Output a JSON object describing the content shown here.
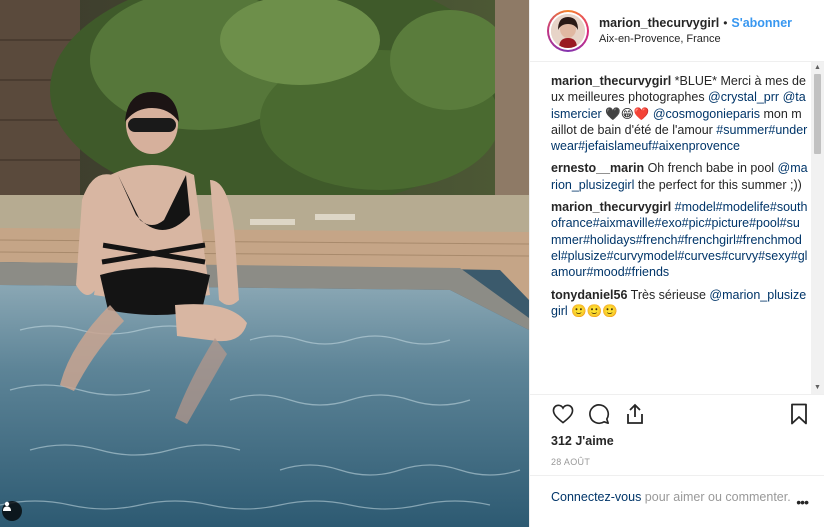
{
  "header": {
    "username": "marion_thecurvygirl",
    "separator": "•",
    "follow_label": "S'abonner",
    "location": "Aix-en-Provence, France"
  },
  "comments": [
    {
      "username": "marion_thecurvygirl",
      "parts": [
        {
          "text": " *BLUE* Merci à mes deux meilleures photographes ",
          "link": false
        },
        {
          "text": "@crystal_prr",
          "link": true
        },
        {
          "text": " ",
          "link": false
        },
        {
          "text": "@taismercier",
          "link": true
        },
        {
          "text": " 🖤😁❤️ ",
          "link": false
        },
        {
          "text": "@cosmogonieparis",
          "link": true
        },
        {
          "text": " mon maillot de bain d'été de l'amour ",
          "link": false
        },
        {
          "text": "#summer",
          "link": true
        },
        {
          "text": "#underwear",
          "link": true
        },
        {
          "text": "#jefaislameuf",
          "link": true
        },
        {
          "text": "#aixenprovence",
          "link": true
        }
      ]
    },
    {
      "username": "ernesto__marin",
      "parts": [
        {
          "text": " Oh french babe in pool ",
          "link": false
        },
        {
          "text": "@marion_plusizegirl",
          "link": true
        },
        {
          "text": " the perfect for this summer ;))",
          "link": false
        }
      ]
    },
    {
      "username": "marion_thecurvygirl",
      "parts": [
        {
          "text": " ",
          "link": false
        },
        {
          "text": "#model",
          "link": true
        },
        {
          "text": "#modelife",
          "link": true
        },
        {
          "text": "#southofrance",
          "link": true
        },
        {
          "text": "#aixmaville",
          "link": true
        },
        {
          "text": "#exo",
          "link": true
        },
        {
          "text": "#pic",
          "link": true
        },
        {
          "text": "#picture",
          "link": true
        },
        {
          "text": "#pool",
          "link": true
        },
        {
          "text": "#summer",
          "link": true
        },
        {
          "text": "#holidays",
          "link": true
        },
        {
          "text": "#french",
          "link": true
        },
        {
          "text": "#frenchgirl",
          "link": true
        },
        {
          "text": "#frenchmodel",
          "link": true
        },
        {
          "text": "#plusize",
          "link": true
        },
        {
          "text": "#curvymodel",
          "link": true
        },
        {
          "text": "#curves",
          "link": true
        },
        {
          "text": "#curvy",
          "link": true
        },
        {
          "text": "#sexy",
          "link": true
        },
        {
          "text": "#glamour",
          "link": true
        },
        {
          "text": "#mood",
          "link": true
        },
        {
          "text": "#friends",
          "link": true
        }
      ]
    },
    {
      "username": "tonydaniel56",
      "parts": [
        {
          "text": " Très sérieuse ",
          "link": false
        },
        {
          "text": "@marion_plusizegirl",
          "link": true
        },
        {
          "text": " 🙂🙂🙂",
          "link": false
        }
      ]
    }
  ],
  "actions": {
    "like_icon": "heart-icon",
    "comment_icon": "comment-icon",
    "share_icon": "share-icon",
    "save_icon": "bookmark-icon"
  },
  "likes_text": "312 J'aime",
  "date_text": "28 AOÛT",
  "login": {
    "link_text": "Connectez-vous",
    "rest_text": " pour aimer ou commenter.",
    "more_label": "•••"
  },
  "colors": {
    "link": "#003569",
    "follow": "#3897f0",
    "muted": "#999999"
  }
}
